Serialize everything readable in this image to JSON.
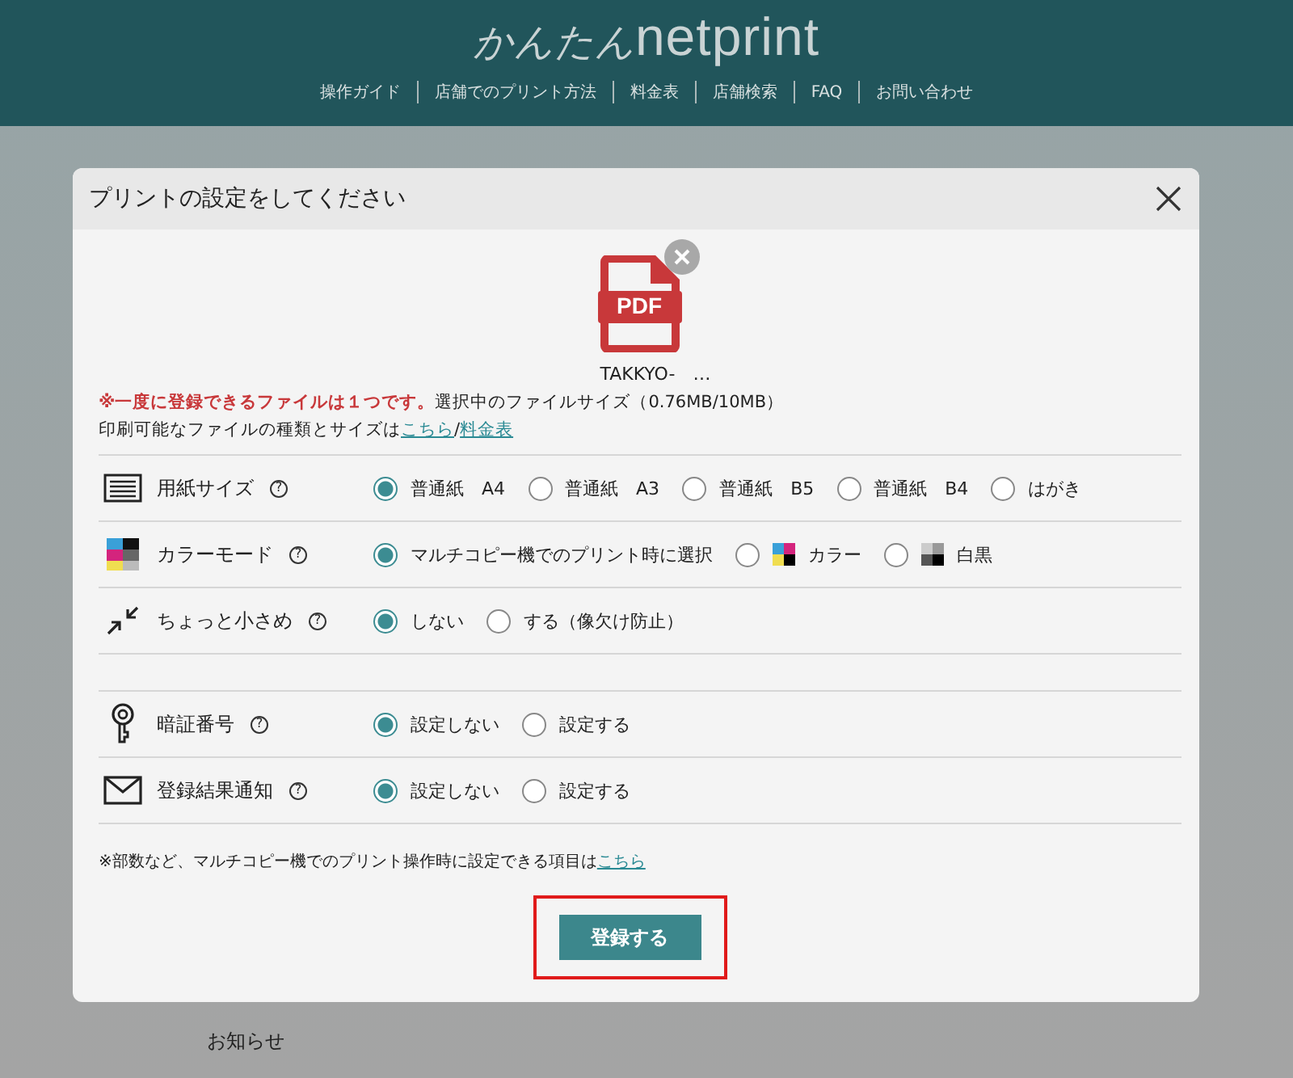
{
  "header": {
    "logo_kana": "かんたん",
    "logo_latin": "netprint",
    "nav": [
      "操作ガイド",
      "店舗でのプリント方法",
      "料金表",
      "店舗検索",
      "FAQ",
      "お問い合わせ"
    ]
  },
  "dialog": {
    "title": "プリントの設定をしてください",
    "file": {
      "name": "TAKKYO-　…",
      "type_label": "PDF"
    },
    "notice": {
      "warning": "※一度に登録できるファイルは１つです。",
      "size": "選択中のファイルサイズ（0.76MB/10MB）"
    },
    "info": {
      "text": "印刷可能なファイルの種類とサイズは",
      "links": [
        "こちら",
        "料金表"
      ],
      "separator": "/"
    },
    "settings": [
      {
        "kind": "setting",
        "label": "用紙サイズ",
        "help": "?",
        "options": [
          {
            "label": "普通紙　A4",
            "selected": true
          },
          {
            "label": "普通紙　A3",
            "selected": false
          },
          {
            "label": "普通紙　B5",
            "selected": false
          },
          {
            "label": "普通紙　B4",
            "selected": false
          },
          {
            "label": "はがき",
            "selected": false
          }
        ]
      },
      {
        "kind": "setting",
        "label": "カラーモード",
        "help": "?",
        "options": [
          {
            "label": "マルチコピー機でのプリント時に選択",
            "selected": true
          },
          {
            "label": "カラー",
            "selected": false
          },
          {
            "label": "白黒",
            "selected": false
          }
        ]
      },
      {
        "kind": "setting",
        "label": "ちょっと小さめ",
        "help": "?",
        "options": [
          {
            "label": "しない",
            "selected": true
          },
          {
            "label": "する（像欠け防止）",
            "selected": false
          }
        ]
      },
      {
        "kind": "spacer"
      },
      {
        "kind": "setting",
        "label": "暗証番号",
        "help": "?",
        "options": [
          {
            "label": "設定しない",
            "selected": true
          },
          {
            "label": "設定する",
            "selected": false
          }
        ]
      },
      {
        "kind": "setting",
        "label": "登録結果通知",
        "help": "?",
        "options": [
          {
            "label": "設定しない",
            "selected": true
          },
          {
            "label": "設定する",
            "selected": false
          }
        ]
      }
    ],
    "footnote": {
      "text": "※部数など、マルチコピー機でのプリント操作時に設定できる項目は",
      "link": "こちら"
    },
    "submit": {
      "label": "登録する",
      "highlighted": true
    }
  },
  "below": {
    "heading": "お知らせ"
  }
}
